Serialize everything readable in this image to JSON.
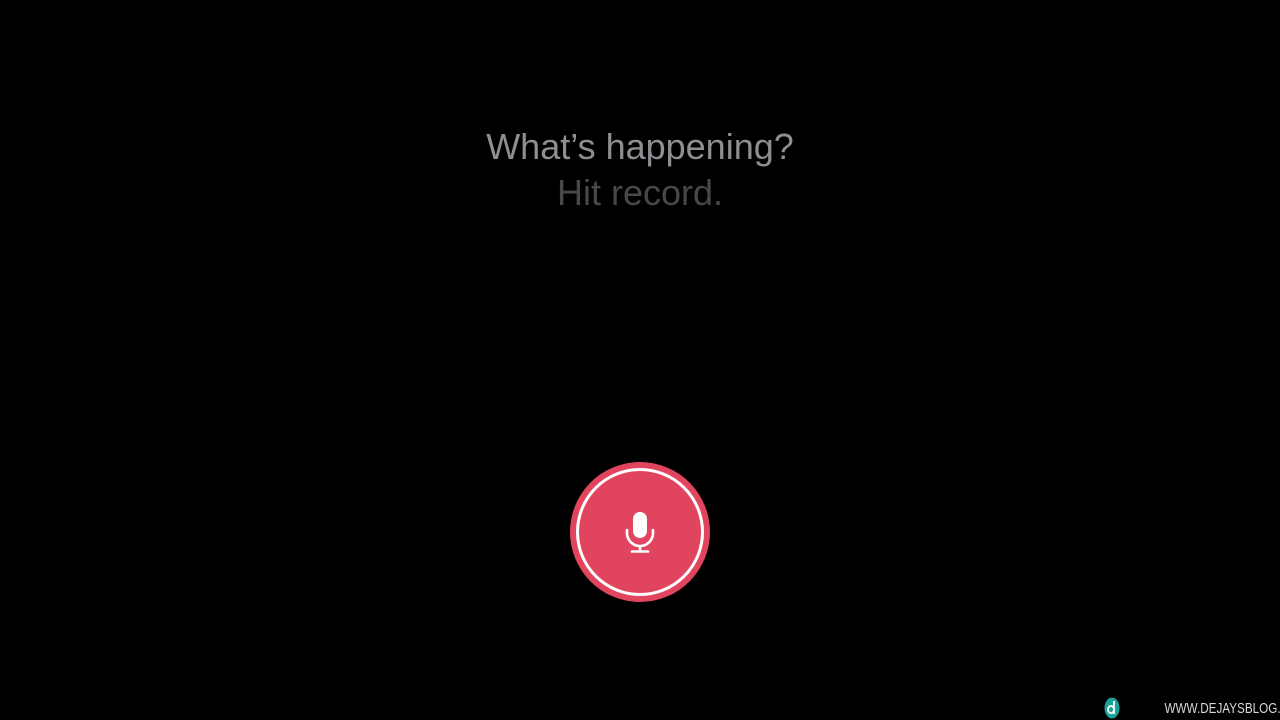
{
  "prompt": {
    "headline": "What’s happening?",
    "subline": "Hit record."
  },
  "record_button": {
    "icon": "microphone-icon",
    "color": "#e0445f",
    "ring_color": "#ffffff"
  },
  "watermark": {
    "text": "WWW.DEJAYSBLOG.COM",
    "logo_color": "#1aa39a"
  },
  "colors": {
    "background": "#000000",
    "headline": "#8e8e93",
    "subline": "#48484a"
  }
}
